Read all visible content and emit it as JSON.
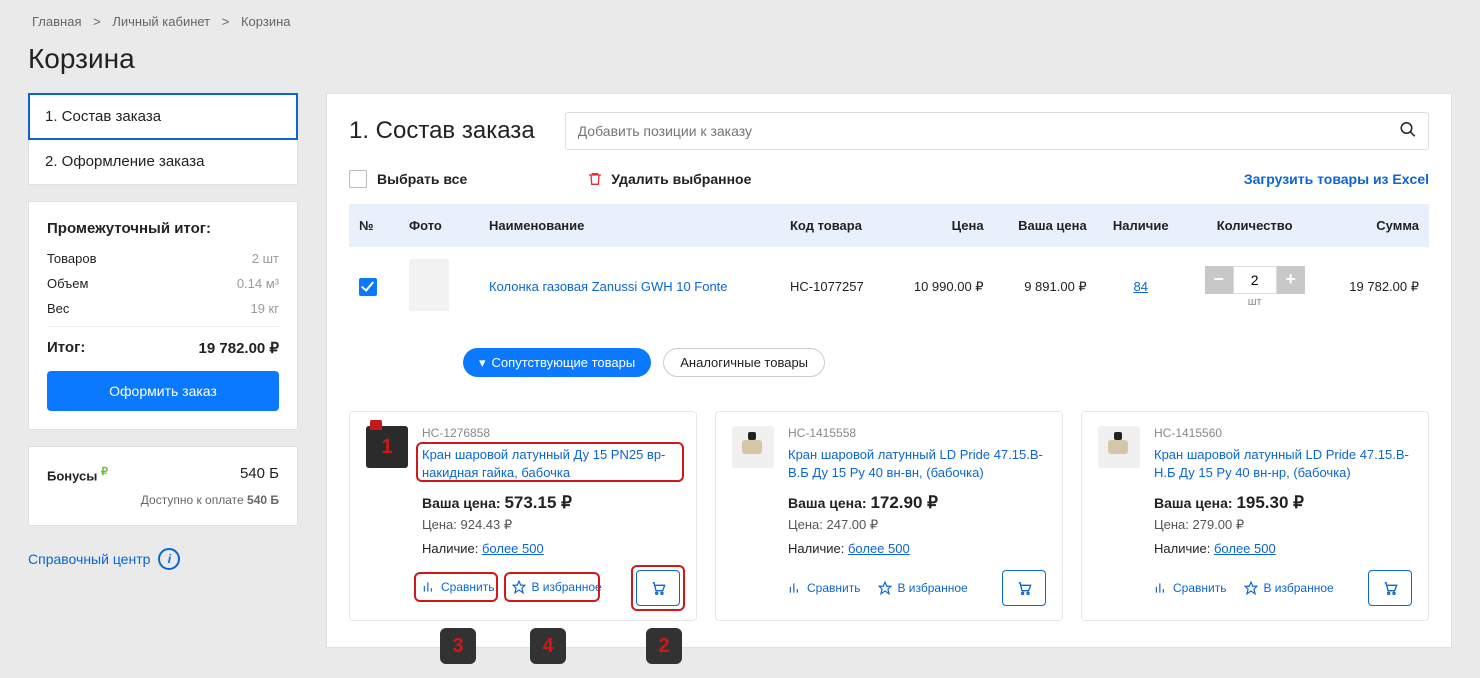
{
  "breadcrumb": [
    "Главная",
    "Личный кабинет",
    "Корзина"
  ],
  "page_title": "Корзина",
  "steps": [
    {
      "label": "1. Состав заказа",
      "active": true
    },
    {
      "label": "2. Оформление заказа",
      "active": false
    }
  ],
  "subtotal_card": {
    "title": "Промежуточный итог:",
    "items_label": "Товаров",
    "items_value": "2 шт",
    "volume_label": "Объем",
    "volume_value": "0.14 м³",
    "weight_label": "Вес",
    "weight_value": "19 кг",
    "total_label": "Итог:",
    "total_value": "19 782.00 ₽",
    "checkout": "Оформить заказ"
  },
  "bonus_card": {
    "title": "Бонусы",
    "value": "540 Б",
    "available_label": "Доступно к оплате",
    "available_value": "540 Б"
  },
  "help": {
    "label": "Справочный центр"
  },
  "section": {
    "title": "1. Состав заказа",
    "search_placeholder": "Добавить позиции к заказу"
  },
  "toolbar": {
    "select_all": "Выбрать все",
    "delete_selected": "Удалить выбранное",
    "excel": "Загрузить товары из Excel"
  },
  "columns": {
    "num": "№",
    "photo": "Фото",
    "name": "Наименование",
    "sku": "Код товара",
    "price": "Цена",
    "your_price": "Ваша цена",
    "stock": "Наличие",
    "qty": "Количество",
    "sum": "Сумма"
  },
  "row": {
    "name": "Колонка газовая Zanussi GWH 10 Fonte",
    "sku": "НС-1077257",
    "price": "10 990.00 ₽",
    "your_price": "9 891.00 ₽",
    "stock": "84",
    "qty": "2",
    "qty_unit": "шт",
    "sum": "19 782.00 ₽"
  },
  "tabs": {
    "accompanying": "Сопутствующие товары",
    "analog": "Аналогичные товары",
    "chev": "▾"
  },
  "products": [
    {
      "sku": "НС-1276858",
      "name": "Кран шаровой латунный Ду 15 PN25 вр-накидная гайка, бабочка",
      "your_label": "Ваша цена:",
      "your_price": "573.15 ₽",
      "orig_label": "Цена:",
      "orig_price": "924.43 ₽",
      "avail_label": "Наличие:",
      "avail_value": "более 500",
      "compare": "Сравнить",
      "fav": "В избранное"
    },
    {
      "sku": "НС-1415558",
      "name": "Кран шаровой латунный LD Pride 47.15.В-В.Б Ду 15 Ру 40 вн-вн, (бабочка)",
      "your_label": "Ваша цена:",
      "your_price": "172.90 ₽",
      "orig_label": "Цена:",
      "orig_price": "247.00 ₽",
      "avail_label": "Наличие:",
      "avail_value": "более 500",
      "compare": "Сравнить",
      "fav": "В избранное"
    },
    {
      "sku": "НС-1415560",
      "name": "Кран шаровой латунный LD Pride 47.15.В-Н.Б Ду 15 Ру 40 вн-нр, (бабочка)",
      "your_label": "Ваша цена:",
      "your_price": "195.30 ₽",
      "orig_label": "Цена:",
      "orig_price": "279.00 ₽",
      "avail_label": "Наличие:",
      "avail_value": "более 500",
      "compare": "Сравнить",
      "fav": "В избранное"
    }
  ],
  "ann": {
    "n1": "1",
    "n2": "2",
    "n3": "3",
    "n4": "4"
  }
}
